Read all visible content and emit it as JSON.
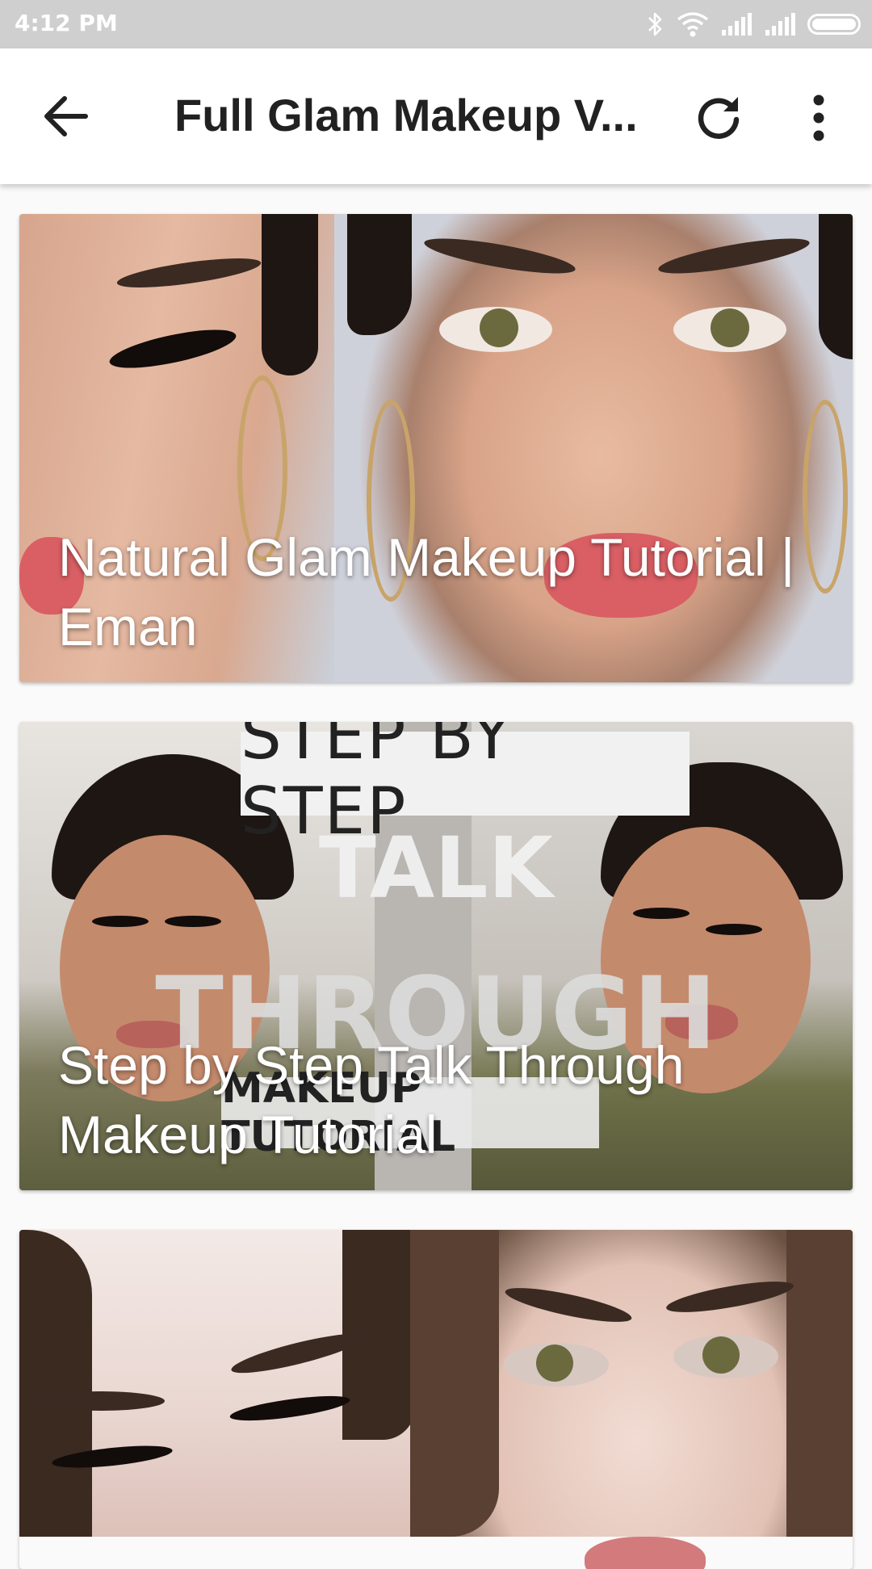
{
  "status_bar": {
    "time": "4:12 PM",
    "icons": [
      "bluetooth-icon",
      "wifi-icon",
      "signal-icon",
      "signal-icon",
      "battery-icon"
    ]
  },
  "app_bar": {
    "title": "Full Glam Makeup V...",
    "actions": [
      "back-arrow-icon",
      "refresh-icon",
      "more-vert-icon"
    ]
  },
  "videos": [
    {
      "title": "Natural Glam Makeup Tutorial | Eman"
    },
    {
      "title": "Step by Step Talk Through Makeup Tutorial",
      "thumb_text": {
        "banner": "STEP BY STEP",
        "line1": "TALK",
        "line2": "THROUGH",
        "footer": "MAKEUP TUTORIAL"
      }
    },
    {
      "title": ""
    }
  ],
  "colors": {
    "status_bar": "#cfcfcf",
    "app_bar": "#ffffff",
    "background": "#fafafa",
    "caption_text": "#ffffff"
  }
}
